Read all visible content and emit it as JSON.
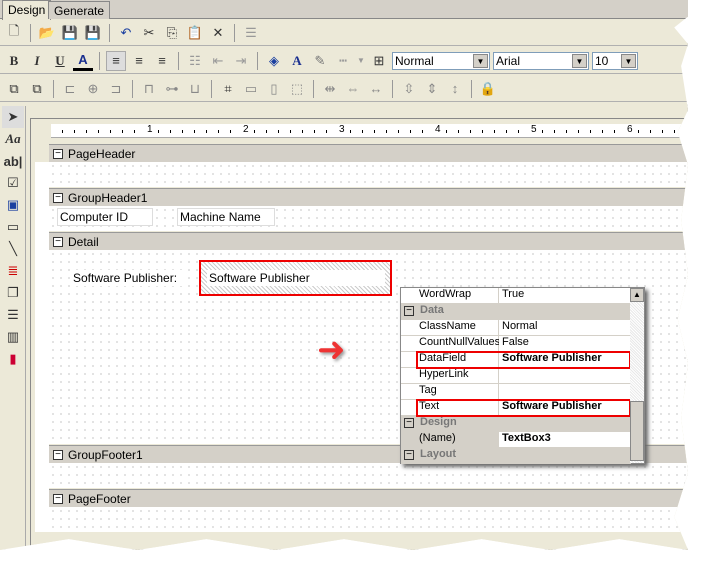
{
  "tabs": [
    "Design",
    "Generate"
  ],
  "toolbar": {
    "style": "Normal",
    "font": "Arial",
    "size": "10"
  },
  "ruler": [
    "1",
    "2",
    "3",
    "4",
    "5",
    "6"
  ],
  "sections": [
    "PageHeader",
    "GroupHeader1",
    "Detail",
    "GroupFooter1",
    "PageFooter"
  ],
  "labels": {
    "computer_id": "Computer ID",
    "machine_name": "Machine Name",
    "sp_label": "Software Publisher:",
    "sp_textbox": "Software Publisher"
  },
  "properties": [
    {
      "name": "WordWrap",
      "value": "True"
    },
    {
      "category": "Data"
    },
    {
      "name": "ClassName",
      "value": "Normal"
    },
    {
      "name": "CountNullValues",
      "value": "False"
    },
    {
      "name": "DataField",
      "value": "Software Publisher"
    },
    {
      "name": "HyperLink",
      "value": ""
    },
    {
      "name": "Tag",
      "value": ""
    },
    {
      "name": "Text",
      "value": "Software Publisher"
    },
    {
      "category": "Design"
    },
    {
      "name": "(Name)",
      "value": "TextBox3"
    },
    {
      "category": "Layout"
    }
  ]
}
